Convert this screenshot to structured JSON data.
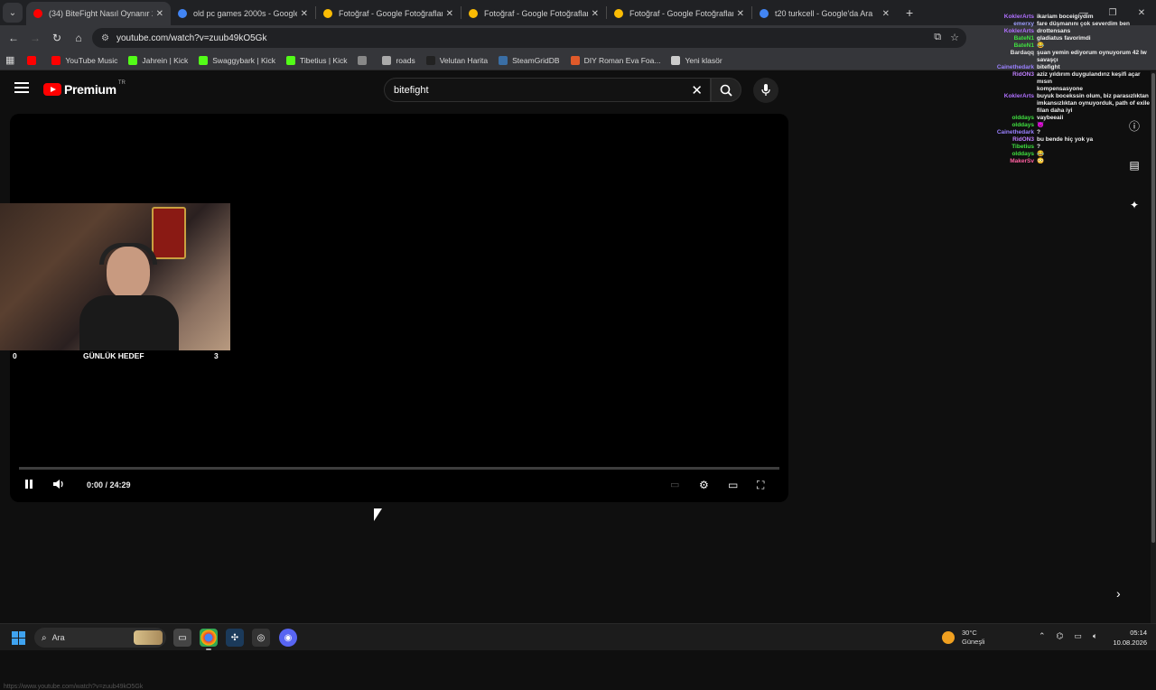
{
  "tabs": [
    {
      "title": "(34) BiteFight Nasıl Oynanır 20",
      "icon": "youtube-icon",
      "color": "#ff0000",
      "active": true
    },
    {
      "title": "old pc games 2000s - Google'd",
      "icon": "google-icon",
      "color": "#4285f4",
      "active": false
    },
    {
      "title": "Fotoğraf - Google Fotoğraflar",
      "icon": "photos-icon",
      "color": "#fbbc04",
      "active": false
    },
    {
      "title": "Fotoğraf - Google Fotoğraflar",
      "icon": "photos-icon",
      "color": "#fbbc04",
      "active": false
    },
    {
      "title": "Fotoğraf - Google Fotoğraflar",
      "icon": "photos-icon",
      "color": "#fbbc04",
      "active": false
    },
    {
      "title": "t20 turkcell - Google'da Ara",
      "icon": "google-icon",
      "color": "#4285f4",
      "active": false
    }
  ],
  "address": {
    "url": "youtube.com/watch?v=zuub49kO5Gk"
  },
  "bookmarks": [
    {
      "label": "",
      "color": "#ff0000",
      "icon": "youtube-icon"
    },
    {
      "label": "YouTube Music",
      "color": "#ff0000",
      "icon": "youtube-music-icon"
    },
    {
      "label": "Jahrein | Kick",
      "color": "#53fc18",
      "icon": "kick-icon"
    },
    {
      "label": "Swaggybark | Kick",
      "color": "#53fc18",
      "icon": "kick-icon"
    },
    {
      "label": "Tibetius | Kick",
      "color": "#53fc18",
      "icon": "kick-icon"
    },
    {
      "label": "",
      "color": "#888888",
      "icon": "globe-icon"
    },
    {
      "label": "roads",
      "color": "#aaaaaa",
      "icon": "roads-icon"
    },
    {
      "label": "Velutan Harita",
      "color": "#222222",
      "icon": "map-icon"
    },
    {
      "label": "SteamGridDB",
      "color": "#3a6ea5",
      "icon": "steamgriddb-icon"
    },
    {
      "label": "DIY Roman Eva Foa...",
      "color": "#e05a2a",
      "icon": "etsy-icon"
    },
    {
      "label": "Yeni klasör",
      "color": "#cccccc",
      "icon": "folder-icon"
    }
  ],
  "youtube": {
    "logo_text": "Premium",
    "logo_region": "TR",
    "search_value": "bitefight"
  },
  "overlay": {
    "goal_left": "0",
    "goal_label": "GÜNLÜK HEDEF",
    "goal_right": "3"
  },
  "player": {
    "time": "0:00 / 24:29",
    "progress": 0
  },
  "chat": [
    {
      "user": "KoklerArts",
      "color": "#b070ff",
      "text": "ikariam boceigiydim"
    },
    {
      "user": "emerxy",
      "color": "#a0a0ff",
      "text": "fare düşmanını çok severdim ben"
    },
    {
      "user": "KoklerArts",
      "color": "#b070ff",
      "text": "drottensans"
    },
    {
      "user": "BateN1",
      "color": "#40e040",
      "text": "gladiatus favorimdi"
    },
    {
      "user": "BateN1",
      "color": "#40e040",
      "text": "😂"
    },
    {
      "user": "Bardaqq",
      "color": "#e0e0e0",
      "text": "şuan yemin ediyorum oynuyorum 42 lw savaşçı"
    },
    {
      "user": "Cainethedark",
      "color": "#9a80ff",
      "text": "bitefight"
    },
    {
      "user": "RidON3",
      "color": "#c080ff",
      "text": "aziz yıldırım duygulandırız keşifi açar mısın"
    },
    {
      "user": "",
      "color": "#e0e0e0",
      "text": "kompensasyone"
    },
    {
      "user": "KoklerArts",
      "color": "#b070ff",
      "text": "buyuk bocekssin olum, biz parasızlıktan imkansızlıktan oynuyorduk, path of exile filan daha iyi"
    },
    {
      "user": "olddays",
      "color": "#40e040",
      "text": "vaybeeaii"
    },
    {
      "user": "olddays",
      "color": "#40e040",
      "text": "😈"
    },
    {
      "user": "Cainethedark",
      "color": "#9a80ff",
      "text": "?"
    },
    {
      "user": "RidON3",
      "color": "#c080ff",
      "text": "bu bende hiç yok ya"
    },
    {
      "user": "Tibetius",
      "color": "#40e040",
      "text": "?"
    },
    {
      "user": "olddays",
      "color": "#40e040",
      "text": "😂"
    },
    {
      "user": "MakerSv",
      "color": "#ff60a0",
      "text": "😳"
    }
  ],
  "statusbar_url": "https://www.youtube.com/watch?v=zuub49kO5Gk",
  "taskbar": {
    "search_placeholder": "Ara",
    "weather_temp": "30°C",
    "weather_desc": "Güneşli",
    "time": "05:14",
    "date": "10.08.2026"
  }
}
